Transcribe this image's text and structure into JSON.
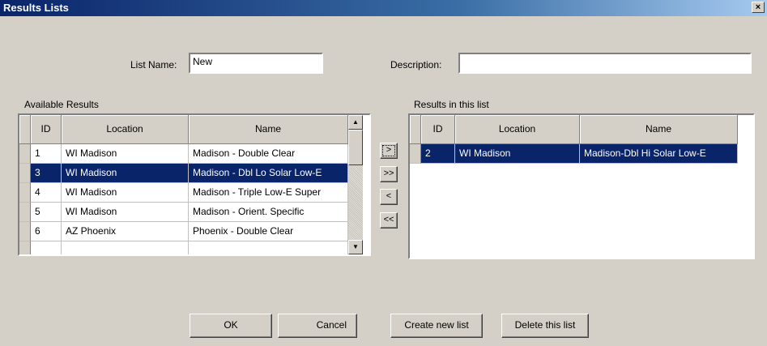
{
  "window": {
    "title": "Results Lists",
    "close_glyph": "×"
  },
  "form": {
    "list_name_label": "List Name:",
    "list_name_value": "New",
    "description_label": "Description:",
    "description_value": ""
  },
  "available": {
    "label": "Available Results",
    "columns": [
      "ID",
      "Location",
      "Name"
    ],
    "rows": [
      {
        "id": "1",
        "location": "WI Madison",
        "name": "Madison - Double Clear",
        "selected": false
      },
      {
        "id": "3",
        "location": "WI Madison",
        "name": "Madison - Dbl Lo Solar Low-E",
        "selected": true
      },
      {
        "id": "4",
        "location": "WI Madison",
        "name": "Madison - Triple Low-E Super",
        "selected": false
      },
      {
        "id": "5",
        "location": "WI Madison",
        "name": "Madison - Orient. Specific",
        "selected": false
      },
      {
        "id": "6",
        "location": "AZ Phoenix",
        "name": "Phoenix - Double Clear",
        "selected": false
      }
    ]
  },
  "in_list": {
    "label": "Results in this list",
    "columns": [
      "ID",
      "Location",
      "Name"
    ],
    "rows": [
      {
        "id": "2",
        "location": "WI Madison",
        "name": "Madison-Dbl Hi Solar Low-E",
        "selected": true
      }
    ]
  },
  "move_buttons": {
    "add_one": ">",
    "add_all": ">>",
    "remove_one": "<",
    "remove_all": "<<"
  },
  "actions": {
    "ok": "OK",
    "cancel": "Cancel",
    "create_new": "Create new list",
    "delete": "Delete this list"
  },
  "scroll": {
    "up_glyph": "▲",
    "down_glyph": "▼"
  }
}
